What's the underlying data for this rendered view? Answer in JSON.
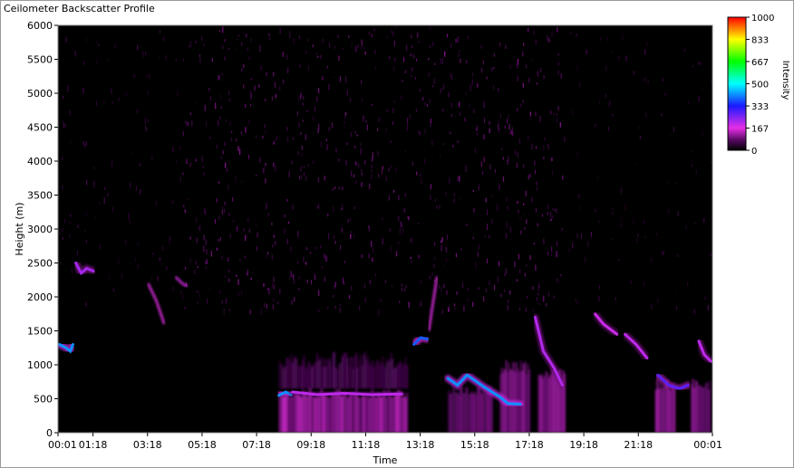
{
  "window": {
    "title": "Ceilometer Backscatter Profile"
  },
  "chart_data": {
    "type": "heatmap",
    "title": "",
    "xlabel": "Time",
    "ylabel": "Height (m)",
    "x_unit": "hours",
    "xlim": [
      0.0,
      24.0
    ],
    "ylim": [
      0,
      6000
    ],
    "xticks": [
      {
        "value": 0.0,
        "label": "00:01"
      },
      {
        "value": 1.283,
        "label": "01:18"
      },
      {
        "value": 3.283,
        "label": "03:18"
      },
      {
        "value": 5.283,
        "label": "05:18"
      },
      {
        "value": 7.283,
        "label": "07:18"
      },
      {
        "value": 9.283,
        "label": "09:18"
      },
      {
        "value": 11.283,
        "label": "11:18"
      },
      {
        "value": 13.283,
        "label": "13:18"
      },
      {
        "value": 15.283,
        "label": "15:18"
      },
      {
        "value": 17.283,
        "label": "17:18"
      },
      {
        "value": 19.283,
        "label": "19:18"
      },
      {
        "value": 21.283,
        "label": "21:18"
      },
      {
        "value": 24.0,
        "label": "00:01"
      }
    ],
    "yticks": [
      0,
      500,
      1000,
      1500,
      2000,
      2500,
      3000,
      3500,
      4000,
      4500,
      5000,
      5500,
      6000
    ],
    "colorbar": {
      "label": "Intensity",
      "min": 0,
      "max": 1000,
      "ticks": [
        {
          "value": 0,
          "label": "0"
        },
        {
          "value": 167,
          "label": "167"
        },
        {
          "value": 333,
          "label": "333"
        },
        {
          "value": 500,
          "label": "500"
        },
        {
          "value": 667,
          "label": "667"
        },
        {
          "value": 833,
          "label": "833"
        },
        {
          "value": 1000,
          "label": "1000"
        }
      ],
      "colors": [
        {
          "value": 0,
          "color": "#000000"
        },
        {
          "value": 80,
          "color": "#5a0a66"
        },
        {
          "value": 167,
          "color": "#e62ee6"
        },
        {
          "value": 333,
          "color": "#1a1aff"
        },
        {
          "value": 500,
          "color": "#00ffff"
        },
        {
          "value": 667,
          "color": "#00ff00"
        },
        {
          "value": 833,
          "color": "#ffff00"
        },
        {
          "value": 1000,
          "color": "#ff0000"
        }
      ]
    },
    "background_noise": {
      "from_height": 1800,
      "to_height": 6000,
      "intensity": 110,
      "peak_intensity": 190,
      "active_time_range": [
        4.5,
        18.5
      ]
    },
    "low_level_returns": [
      {
        "t0": 8.1,
        "t1": 12.8,
        "h0": 0,
        "h1": 650,
        "intensity": 150
      },
      {
        "t0": 8.1,
        "t1": 12.8,
        "h0": 650,
        "h1": 1200,
        "intensity": 75
      },
      {
        "t0": 14.3,
        "t1": 15.9,
        "h0": 0,
        "h1": 700,
        "intensity": 110
      },
      {
        "t0": 16.2,
        "t1": 17.3,
        "h0": 0,
        "h1": 1100,
        "intensity": 130
      },
      {
        "t0": 17.6,
        "t1": 18.6,
        "h0": 0,
        "h1": 1000,
        "intensity": 130
      },
      {
        "t0": 21.9,
        "t1": 22.6,
        "h0": 0,
        "h1": 800,
        "intensity": 130
      },
      {
        "t0": 23.2,
        "t1": 23.9,
        "h0": 0,
        "h1": 800,
        "intensity": 120
      }
    ],
    "cloud_layers": [
      {
        "points": [
          [
            0.05,
            1300
          ],
          [
            0.3,
            1250
          ],
          [
            0.45,
            1200
          ],
          [
            0.55,
            1300
          ]
        ],
        "intensity": 420
      },
      {
        "points": [
          [
            0.65,
            2500
          ],
          [
            0.85,
            2350
          ],
          [
            1.05,
            2420
          ],
          [
            1.3,
            2380
          ]
        ],
        "intensity": 220
      },
      {
        "points": [
          [
            8.1,
            550
          ],
          [
            8.35,
            600
          ],
          [
            8.55,
            560
          ]
        ],
        "intensity": 420
      },
      {
        "points": [
          [
            8.6,
            600
          ],
          [
            9.5,
            560
          ],
          [
            10.5,
            580
          ],
          [
            11.5,
            560
          ],
          [
            12.6,
            570
          ]
        ],
        "intensity": 200
      },
      {
        "points": [
          [
            13.05,
            1300
          ],
          [
            13.3,
            1400
          ],
          [
            13.55,
            1380
          ]
        ],
        "intensity": 380
      },
      {
        "points": [
          [
            14.3,
            800
          ],
          [
            14.65,
            700
          ],
          [
            15.0,
            850
          ],
          [
            15.6,
            680
          ],
          [
            16.2,
            530
          ],
          [
            16.5,
            430
          ],
          [
            16.95,
            420
          ]
        ],
        "intensity": 420
      },
      {
        "points": [
          [
            17.5,
            1700
          ],
          [
            17.8,
            1200
          ],
          [
            18.2,
            950
          ],
          [
            18.5,
            700
          ]
        ],
        "intensity": 210
      },
      {
        "points": [
          [
            19.7,
            1750
          ],
          [
            20.0,
            1600
          ],
          [
            20.5,
            1450
          ]
        ],
        "intensity": 190
      },
      {
        "points": [
          [
            20.8,
            1450
          ],
          [
            21.2,
            1300
          ],
          [
            21.6,
            1100
          ]
        ],
        "intensity": 200
      },
      {
        "points": [
          [
            22.0,
            850
          ],
          [
            22.4,
            700
          ],
          [
            22.8,
            650
          ],
          [
            23.1,
            700
          ]
        ],
        "intensity": 280
      },
      {
        "points": [
          [
            23.5,
            1350
          ],
          [
            23.7,
            1150
          ],
          [
            23.95,
            1050
          ]
        ],
        "intensity": 200
      }
    ],
    "plumes": [
      {
        "points": [
          [
            3.3,
            2200
          ],
          [
            3.6,
            1950
          ],
          [
            3.9,
            1600
          ]
        ],
        "intensity": 170
      },
      {
        "points": [
          [
            4.3,
            2300
          ],
          [
            4.55,
            2200
          ],
          [
            4.75,
            2150
          ]
        ],
        "intensity": 180
      },
      {
        "points": [
          [
            13.6,
            1500
          ],
          [
            13.75,
            1900
          ],
          [
            13.9,
            2300
          ]
        ],
        "intensity": 170
      }
    ]
  }
}
